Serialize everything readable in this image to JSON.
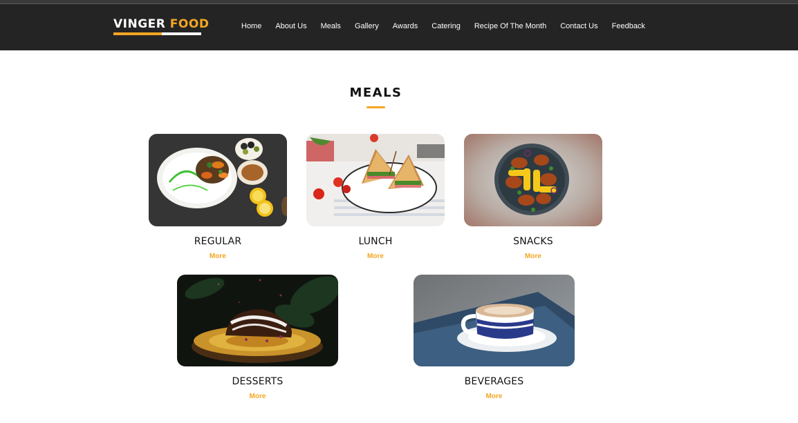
{
  "brand": {
    "word1": "VINGER",
    "word2": "FOOD",
    "accent": "#f5a623",
    "nav_bg": "#242424"
  },
  "nav": {
    "items": [
      {
        "label": "Home"
      },
      {
        "label": "About Us"
      },
      {
        "label": "Meals"
      },
      {
        "label": "Gallery"
      },
      {
        "label": "Awards"
      },
      {
        "label": "Catering"
      },
      {
        "label": "Recipe Of The Month"
      },
      {
        "label": "Contact Us"
      },
      {
        "label": "Feedback"
      }
    ]
  },
  "section": {
    "title": "MEALS"
  },
  "meals": [
    {
      "name": "REGULAR",
      "more": "More",
      "image": "grilled-vegetable-plate-photo"
    },
    {
      "name": "LUNCH",
      "more": "More",
      "image": "grilled-sandwich-photo"
    },
    {
      "name": "SNACKS",
      "more": "More",
      "image": "chicken-wings-corn-photo"
    },
    {
      "name": "DESSERTS",
      "more": "More",
      "image": "chocolate-cake-photo"
    },
    {
      "name": "BEVERAGES",
      "more": "More",
      "image": "coffee-cup-photo"
    }
  ]
}
